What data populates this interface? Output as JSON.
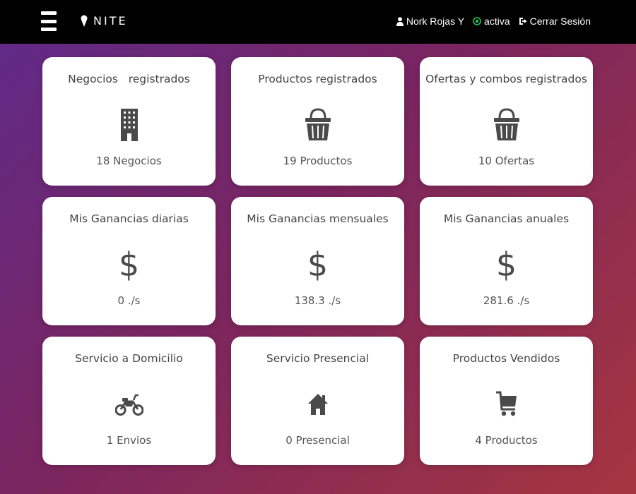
{
  "header": {
    "menu_icon": "hamburger-icon",
    "logo_text": "NITE",
    "logo_icon": "ice-cream-icon",
    "user_name": "Nork Rojas Y",
    "user_icon": "user-icon",
    "status_text": "activa",
    "status_icon": "status-dot-icon",
    "status_color": "#22c55e",
    "logout_text": "Cerrar Sesión",
    "logout_icon": "sign-out-icon"
  },
  "cards": [
    {
      "title": "Negocios   registrados",
      "icon": "building-icon",
      "value": "18 Negocios"
    },
    {
      "title": "Productos registrados",
      "icon": "basket-icon",
      "value": "19 Productos"
    },
    {
      "title": "Ofertas y combos registrados",
      "icon": "basket-icon",
      "value": "10 Ofertas"
    },
    {
      "title": "Mis Ganancias diarias",
      "icon": "dollar-icon",
      "icon_glyph": "$",
      "value": "0 ./s"
    },
    {
      "title": "Mis Ganancias mensuales",
      "icon": "dollar-icon",
      "icon_glyph": "$",
      "value": "138.3 ./s"
    },
    {
      "title": "Mis Ganancias anuales",
      "icon": "dollar-icon",
      "icon_glyph": "$",
      "value": "281.6 ./s"
    },
    {
      "title": "Servicio a Domicilio",
      "icon": "motorcycle-icon",
      "value": "1 Envios"
    },
    {
      "title": "Servicio Presencial",
      "icon": "home-icon",
      "value": "0 Presencial"
    },
    {
      "title": "Productos Vendidos",
      "icon": "shopping-cart-icon",
      "value": "4 Productos"
    }
  ],
  "colors": {
    "topbar": "#000000",
    "gradient_start": "#5e2a8a",
    "gradient_end": "#a6353f",
    "icon": "#4a4a4a"
  }
}
